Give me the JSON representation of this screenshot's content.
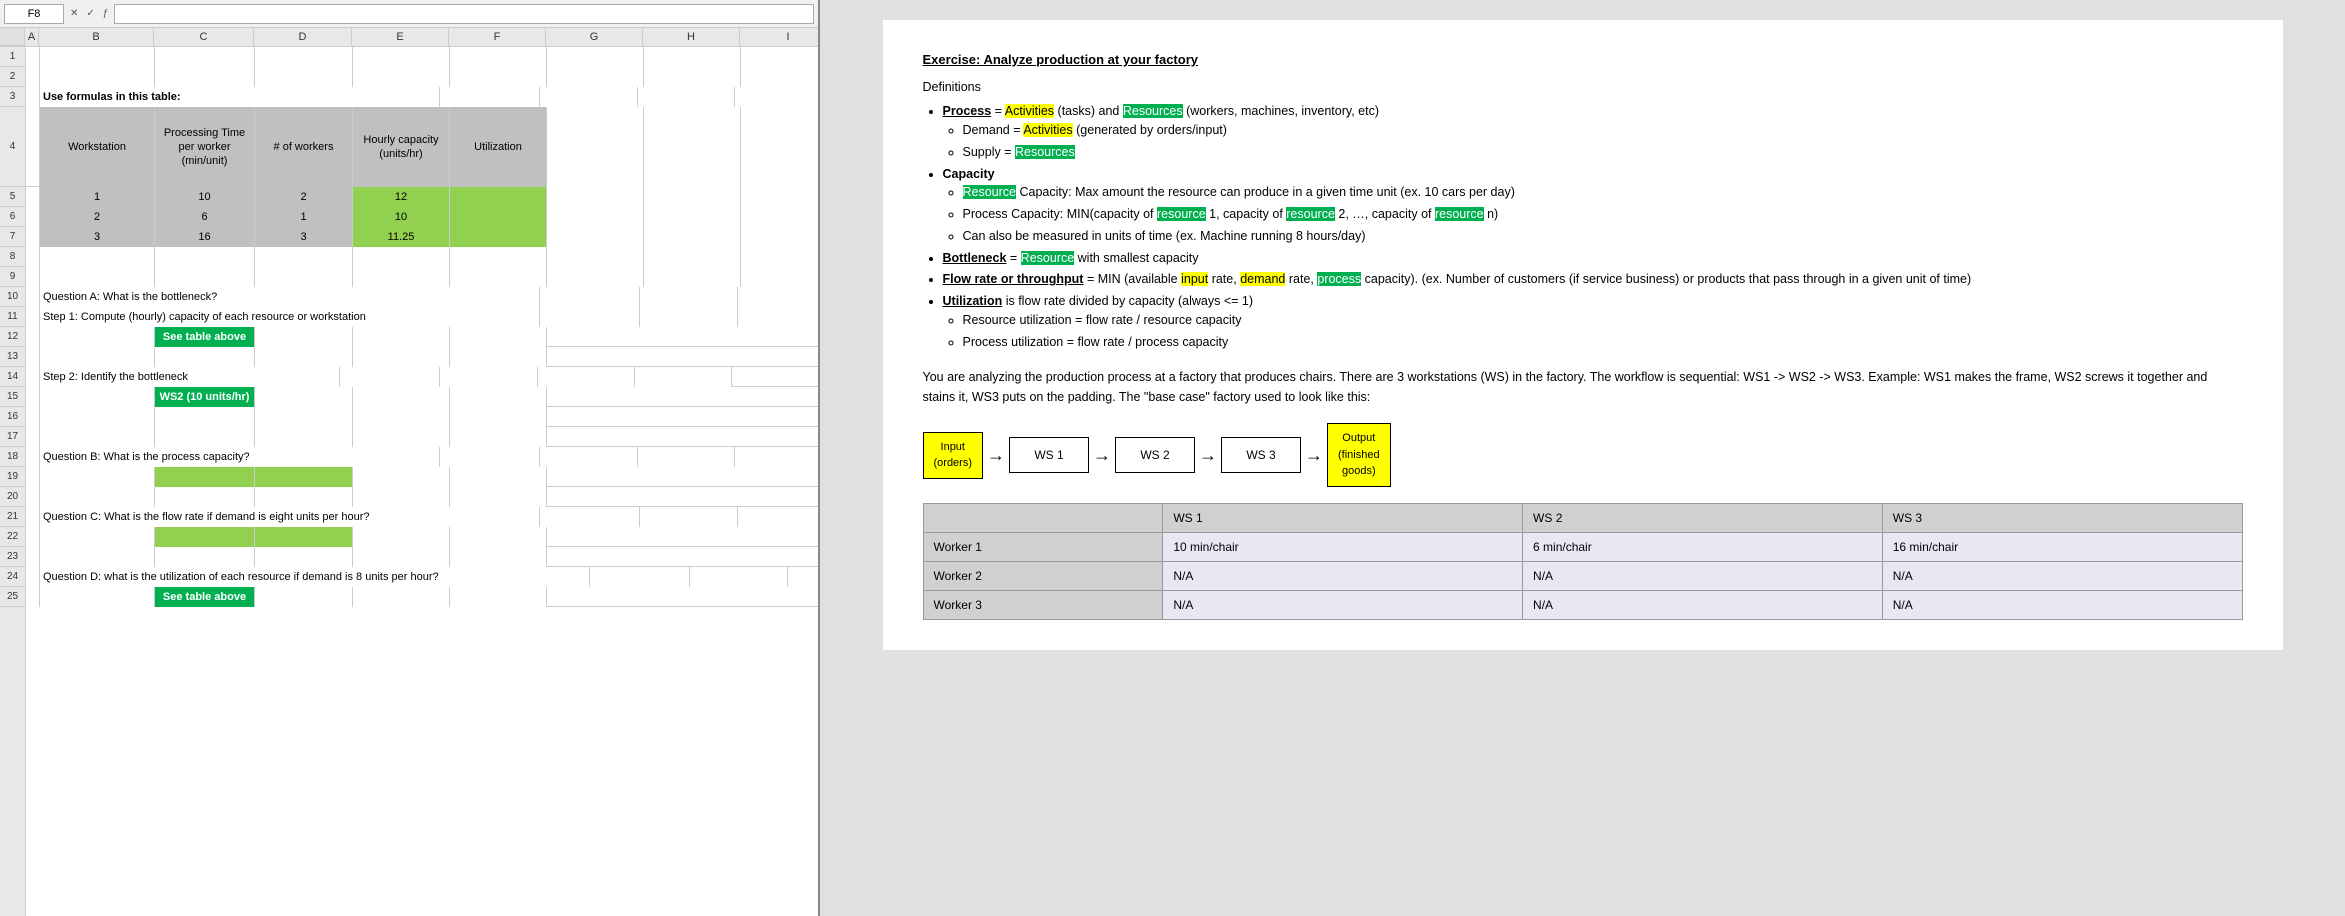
{
  "excel": {
    "name_box": "F8",
    "formula_bar": "",
    "toolbar_icons": [
      "✕",
      "✓",
      "ƒ"
    ],
    "col_headers": [
      "A",
      "B",
      "C",
      "D",
      "E",
      "F",
      "G",
      "H",
      "I"
    ],
    "row_headers": [
      "1",
      "2",
      "3",
      "4",
      "5",
      "6",
      "7",
      "8",
      "9",
      "10",
      "11",
      "12",
      "13",
      "14",
      "15",
      "16",
      "17",
      "18",
      "19",
      "20",
      "21",
      "22",
      "23",
      "24",
      "25"
    ],
    "table_header": {
      "workstation_label": "Workstation",
      "processing_time_label": "Processing Time per worker (min/unit)",
      "num_workers_label": "# of workers",
      "hourly_capacity_label": "Hourly capacity (units/hr)",
      "utilization_label": "Utilization"
    },
    "table_rows": [
      {
        "ws": "1",
        "proc_time": "10",
        "num_workers": "2",
        "hourly_cap": "12",
        "util": ""
      },
      {
        "ws": "2",
        "proc_time": "6",
        "num_workers": "1",
        "hourly_cap": "10",
        "util": ""
      },
      {
        "ws": "3",
        "proc_time": "16",
        "num_workers": "3",
        "hourly_cap": "11.25",
        "util": ""
      }
    ],
    "row3_text": "Use formulas in this table:",
    "q_a_label": "Question A: What is the bottleneck?",
    "step1_label": "Step 1: Compute (hourly) capacity of each resource or workstation",
    "step1_answer": "See table above",
    "step2_label": "Step 2: Identify the bottleneck",
    "step2_answer": "WS2 (10 units/hr)",
    "q_b_label": "Question B: What is the process capacity?",
    "q_c_label": "Question C: What is the flow rate if demand is eight units per hour?",
    "q_d_label": "Question D: what is the utilization of each resource if demand is 8 units per hour?",
    "q_d_answer": "See table above"
  },
  "doc": {
    "title": "Exercise:  Analyze production at your factory",
    "definitions_label": "Definitions",
    "bullets": [
      {
        "main": "Process = Activities (tasks) and Resources (workers, machines, inventory, etc)",
        "sub": [
          "Demand = Activities (generated by orders/input)",
          "Supply = Resources"
        ]
      },
      {
        "main": "Capacity",
        "sub": [
          "Resource Capacity: Max amount the resource can produce in a given time unit (ex. 10 cars per day)",
          "Process Capacity: MIN(capacity of resource 1, capacity of resource 2, …, capacity of resource n)",
          "Can also be measured in units of time (ex. Machine running 8 hours/day)"
        ]
      },
      {
        "main": "Bottleneck = Resource with smallest capacity",
        "sub": []
      },
      {
        "main": "Flow rate or throughput = MIN (available input rate, demand rate, process capacity). (ex. Number of customers (if service business) or products that pass through in a given unit of time)",
        "sub": []
      },
      {
        "main": "Utilization is flow rate divided by capacity (always <= 1)",
        "sub": [
          "Resource utilization = flow rate / resource capacity",
          "Process utilization = flow rate / process capacity"
        ]
      }
    ],
    "paragraph": "You are analyzing the production process at a factory that produces chairs.  There are 3 workstations (WS) in the factory.  The workflow is sequential: WS1 -> WS2 -> WS3.  Example: WS1 makes the frame, WS2 screws it together and stains it, WS3 puts on the padding.  The \"base case\" factory used to look like this:",
    "flow": {
      "input_label": "Input (orders)",
      "ws1_label": "WS 1",
      "ws2_label": "WS 2",
      "ws3_label": "WS 3",
      "output_label": "Output (finished goods)"
    },
    "workers_table": {
      "headers": [
        "",
        "WS 1",
        "WS 2",
        "WS 3"
      ],
      "rows": [
        {
          "label": "Worker 1",
          "ws1": "10 min/chair",
          "ws2": "6 min/chair",
          "ws3": "16 min/chair"
        },
        {
          "label": "Worker 2",
          "ws1": "N/A",
          "ws2": "N/A",
          "ws3": "N/A"
        },
        {
          "label": "Worker 3",
          "ws1": "N/A",
          "ws2": "N/A",
          "ws3": "N/A"
        }
      ]
    }
  }
}
